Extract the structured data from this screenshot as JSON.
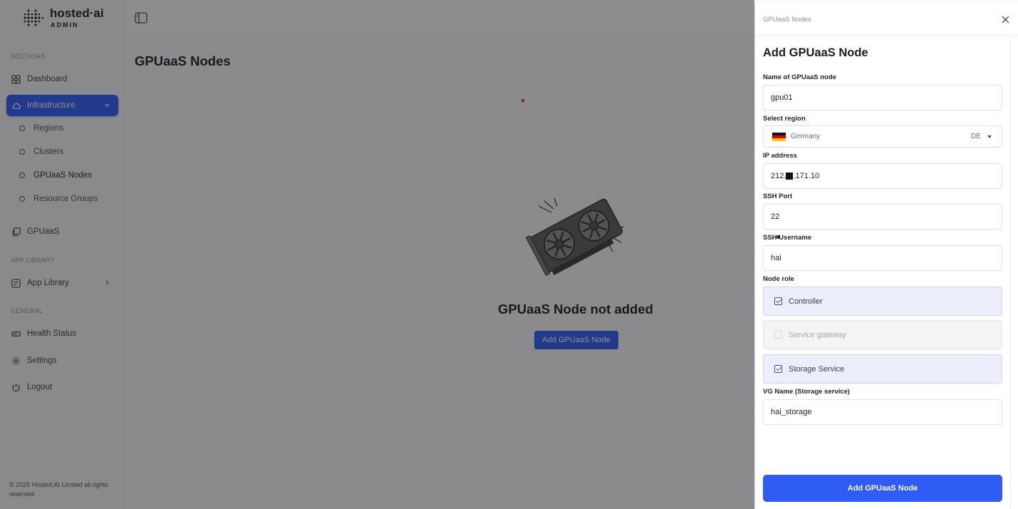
{
  "brand": {
    "name": "hosted·ai",
    "subtitle": "ADMIN"
  },
  "sidebar": {
    "sections_label": "SECTIONS",
    "dashboard": "Dashboard",
    "infrastructure": "Infrastructure",
    "sub_items": [
      "Regions",
      "Clusters",
      "GPUaaS Nodes",
      "Resource Groups"
    ],
    "gpuaas": "GPUaaS",
    "app_library_label": "APP LIBRARY",
    "app_library": "App Library",
    "general_label": "GENERAL",
    "health_status": "Health Status",
    "settings": "Settings",
    "logout": "Logout",
    "footer": "© 2025 Hosted.AI Limited all rights reserved"
  },
  "main": {
    "title": "GPUaaS Nodes",
    "empty_title": "GPUaaS Node not added",
    "empty_button": "Add GPUaaS Node"
  },
  "drawer": {
    "breadcrumb": "GPUaaS Nodes",
    "title": "Add GPUaaS Node",
    "name_label": "Name of GPUaaS node",
    "name_value": "gpu01",
    "region_label": "Select region",
    "region_value": "Germany",
    "region_code": "DE",
    "ip_label": "IP address",
    "ip_prefix": "212.",
    "ip_suffix": ".171.10",
    "port_label": "SSH Port",
    "port_value": "22",
    "user_label": "SSH Username",
    "user_value": "hai",
    "role_label": "Node role",
    "roles": [
      {
        "label": "Controller",
        "checked": true,
        "disabled": false
      },
      {
        "label": "Service gateway",
        "checked": false,
        "disabled": true
      },
      {
        "label": "Storage Service",
        "checked": true,
        "disabled": false
      }
    ],
    "vg_label": "VG Name (Storage service)",
    "vg_value": "hai_storage",
    "submit": "Add GPUaaS Node"
  },
  "colors": {
    "accent": "#2f5cf5",
    "overlay": "rgba(20,20,22,0.48)"
  }
}
